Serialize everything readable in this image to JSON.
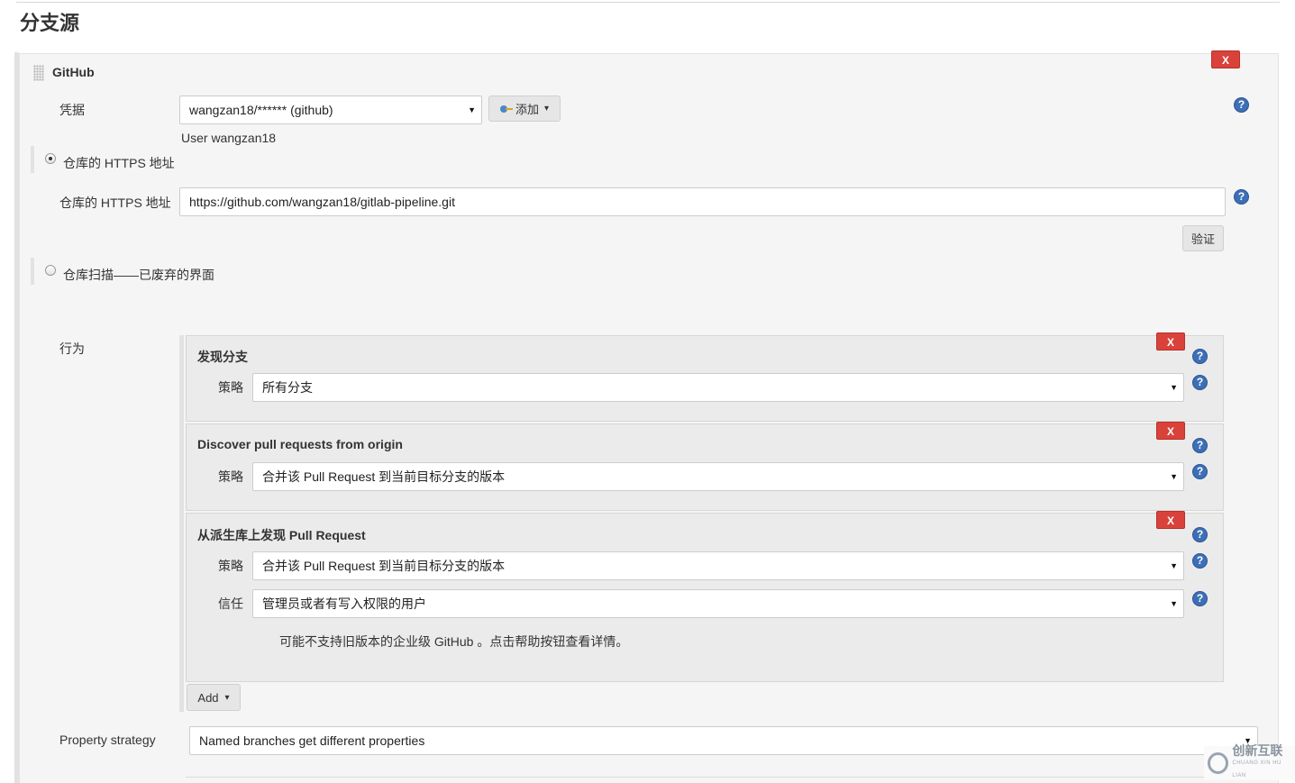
{
  "section_title": "分支源",
  "source": {
    "title": "GitHub",
    "delete_label": "X",
    "credentials": {
      "label": "凭据",
      "value": "wangzan18/****** (github)",
      "add_button": "添加",
      "user_hint": "User wangzan18"
    },
    "mode_https": {
      "label": "仓库的 HTTPS 地址",
      "selected": true,
      "field_label": "仓库的 HTTPS 地址",
      "url": "https://github.com/wangzan18/gitlab-pipeline.git",
      "validate_button": "验证"
    },
    "mode_scan": {
      "label": "仓库扫描——已废弃的界面",
      "selected": false
    },
    "behaviors": {
      "label": "行为",
      "items": [
        {
          "title": "发现分支",
          "strategy_label": "策略",
          "strategy": "所有分支"
        },
        {
          "title": "Discover pull requests from origin",
          "strategy_label": "策略",
          "strategy": "合并该 Pull Request 到当前目标分支的版本"
        },
        {
          "title": "从派生库上发现 Pull Request",
          "strategy_label": "策略",
          "strategy": "合并该 Pull Request 到当前目标分支的版本",
          "trust_label": "信任",
          "trust": "管理员或者有写入权限的用户",
          "note": "可能不支持旧版本的企业级 GitHub 。点击帮助按钮查看详情。"
        }
      ],
      "add_button": "Add"
    },
    "property_strategy": {
      "label": "Property strategy",
      "value": "Named branches get different properties"
    }
  },
  "watermark": {
    "text": "创新互联",
    "sub": "CHUANG XIN HU LIAN"
  },
  "colors": {
    "delete_red": "#d9423a",
    "help_blue": "#3d6fb6",
    "panel_bg": "#f5f5f5",
    "behavior_bg": "#ebebeb"
  },
  "icons": {
    "help": "?",
    "caret": "▼",
    "add_caret": "▾"
  }
}
